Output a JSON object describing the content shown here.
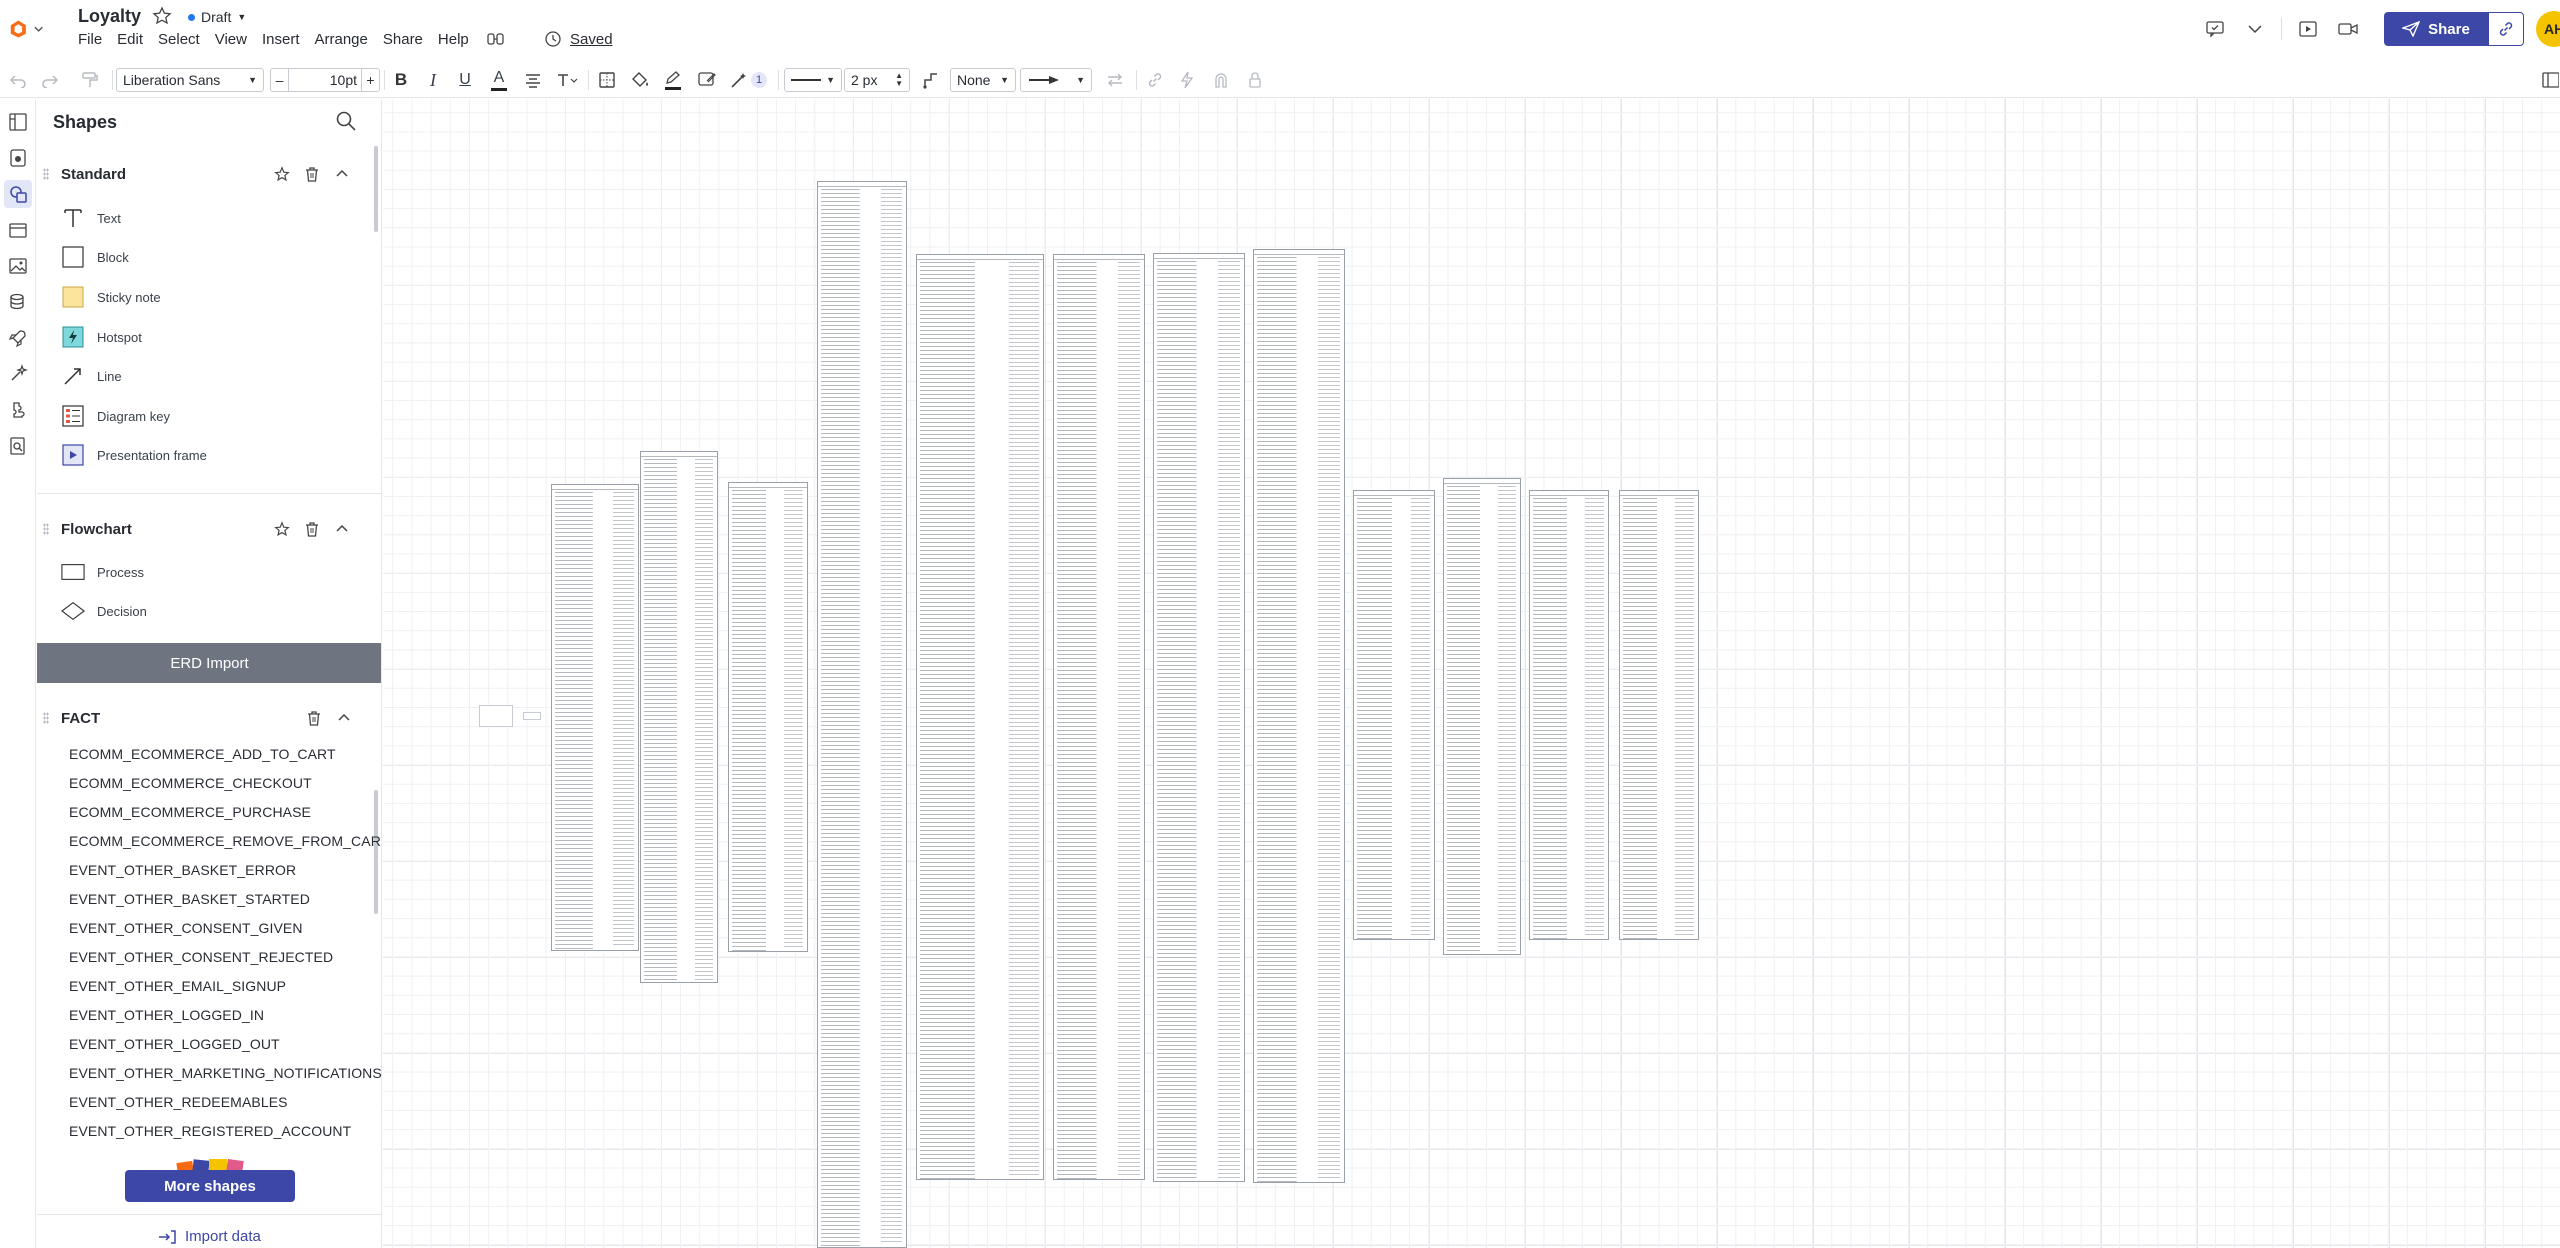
{
  "header": {
    "doc_title": "Loyalty",
    "status": "Draft",
    "saved": "Saved",
    "menu": [
      "File",
      "Edit",
      "Select",
      "View",
      "Insert",
      "Arrange",
      "Share",
      "Help"
    ],
    "share_label": "Share",
    "avatar_initials": "AH"
  },
  "toolbar": {
    "font_family": "Liberation Sans",
    "font_size": "10pt",
    "decrease": "–",
    "increase": "+",
    "bold": "B",
    "italic": "I",
    "underline": "U",
    "text_color": "A",
    "magic_badge": "1",
    "line_width": "2 px",
    "line_start": "None"
  },
  "panel": {
    "title": "Shapes",
    "standard": {
      "name": "Standard",
      "items": [
        "Text",
        "Block",
        "Sticky note",
        "Hotspot",
        "Line",
        "Diagram key",
        "Presentation frame"
      ]
    },
    "flowchart": {
      "name": "Flowchart",
      "items": [
        "Process",
        "Decision"
      ]
    },
    "erd_import": "ERD Import",
    "fact": {
      "name": "FACT",
      "items": [
        "ECOMM_ECOMMERCE_ADD_TO_CART",
        "ECOMM_ECOMMERCE_CHECKOUT",
        "ECOMM_ECOMMERCE_PURCHASE",
        "ECOMM_ECOMMERCE_REMOVE_FROM_CART",
        "EVENT_OTHER_BASKET_ERROR",
        "EVENT_OTHER_BASKET_STARTED",
        "EVENT_OTHER_CONSENT_GIVEN",
        "EVENT_OTHER_CONSENT_REJECTED",
        "EVENT_OTHER_EMAIL_SIGNUP",
        "EVENT_OTHER_LOGGED_IN",
        "EVENT_OTHER_LOGGED_OUT",
        "EVENT_OTHER_MARKETING_NOTIFICATIONS",
        "EVENT_OTHER_REDEEMABLES",
        "EVENT_OTHER_REGISTERED_ACCOUNT"
      ]
    },
    "more_shapes": "More shapes",
    "import_data": "Import data"
  },
  "colors": {
    "brand": "#3d47a5",
    "avatar": "#f4c400",
    "erd_bar": "#6e7580",
    "draft_dot": "#1f7af1"
  }
}
